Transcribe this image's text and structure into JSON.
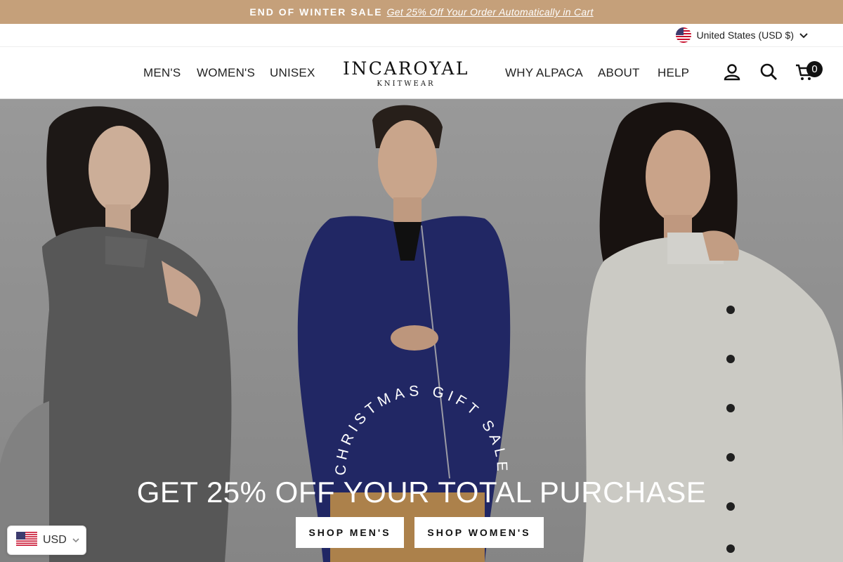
{
  "announcement": {
    "lead": "END OF WINTER SALE",
    "link": "Get 25% Off Your Order Automatically in Cart"
  },
  "utility": {
    "currency_label": "United States (USD $)"
  },
  "nav": {
    "left": [
      "MEN'S",
      "WOMEN'S",
      "UNISEX"
    ],
    "right": [
      "WHY ALPACA",
      "ABOUT",
      "HELP"
    ]
  },
  "logo": {
    "brand": "INCAROYAL",
    "sub": "KNITWEAR"
  },
  "cart": {
    "count": "0"
  },
  "hero": {
    "arc_text": "CHRISTMAS GIFT SALE",
    "headline": "GET 25% OFF YOUR TOTAL PURCHASE",
    "buttons": [
      "SHOP MEN'S",
      "SHOP WOMEN'S"
    ]
  },
  "currency_widget": {
    "code": "USD"
  },
  "colors": {
    "announcement_bg": "#c5a07a",
    "hero_bg": "#9c9c9c"
  }
}
